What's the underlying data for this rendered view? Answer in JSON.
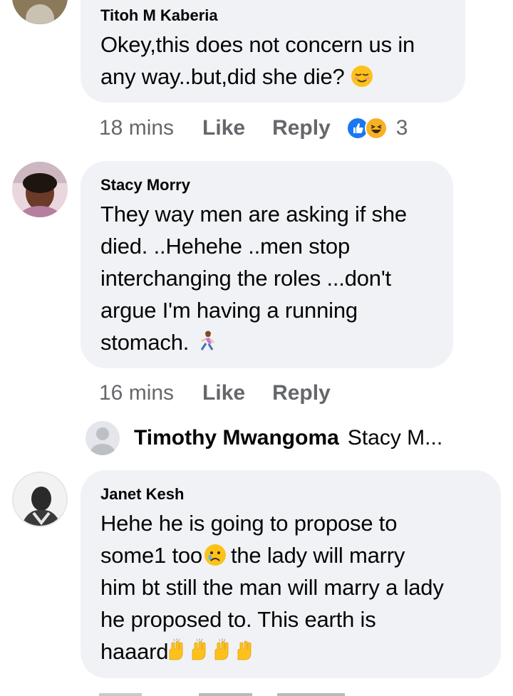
{
  "comments": [
    {
      "author": "Titoh M Kaberia",
      "text_lines": [
        "Okey,this does not concern us in",
        "any way..but,did she die?"
      ],
      "time": "18 mins",
      "like_label": "Like",
      "reply_label": "Reply",
      "reaction_icons": [
        "like-reaction-icon",
        "haha-reaction-icon"
      ],
      "reaction_count": "3"
    },
    {
      "author": "Stacy Morry",
      "text_lines": [
        "They way men are asking if she",
        "died. ..Hehehe ..men stop",
        "interchanging the roles ...don't",
        "argue I'm having a running",
        "stomach."
      ],
      "time": "16 mins",
      "like_label": "Like",
      "reply_label": "Reply",
      "emoji": "woman-running-emoji"
    },
    {
      "author": "Janet Kesh",
      "text_lines": [
        "Hehe he is going to propose to",
        "some1 too",
        "the lady will marry",
        "him bt still the man will marry a lady",
        "he proposed to. This earth is",
        "haaard"
      ],
      "emoji": [
        "crying-face-emoji",
        "raising-hands-emoji"
      ]
    }
  ],
  "reply_preview": {
    "name": "Timothy Mwangoma",
    "text": "Stacy M..."
  },
  "colors": {
    "bubble": "#f0f2f5",
    "meta_text": "#65676b",
    "like_blue": "#1877f2",
    "haha_yellow": "#f7b125"
  }
}
